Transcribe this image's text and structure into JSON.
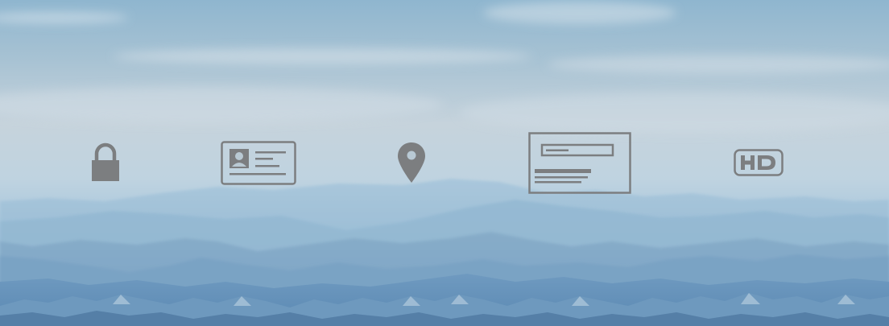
{
  "scene": {
    "background": "mountain-range-hazy-sky",
    "colors": {
      "sky_top": "#8fb7d0",
      "sky_mid": "#c9d6df",
      "haze": "#b4cfe0",
      "mountains_far": "#8fb4cf",
      "mountains_near": "#5f8db5",
      "icon_gray": "#7d7f82"
    }
  },
  "icons": [
    {
      "name": "lock-icon",
      "meaning": "lock"
    },
    {
      "name": "id-card-icon",
      "meaning": "id card"
    },
    {
      "name": "map-pin-icon",
      "meaning": "location"
    },
    {
      "name": "form-layout-icon",
      "meaning": "web form"
    },
    {
      "name": "hd-icon",
      "meaning": "HD"
    }
  ]
}
